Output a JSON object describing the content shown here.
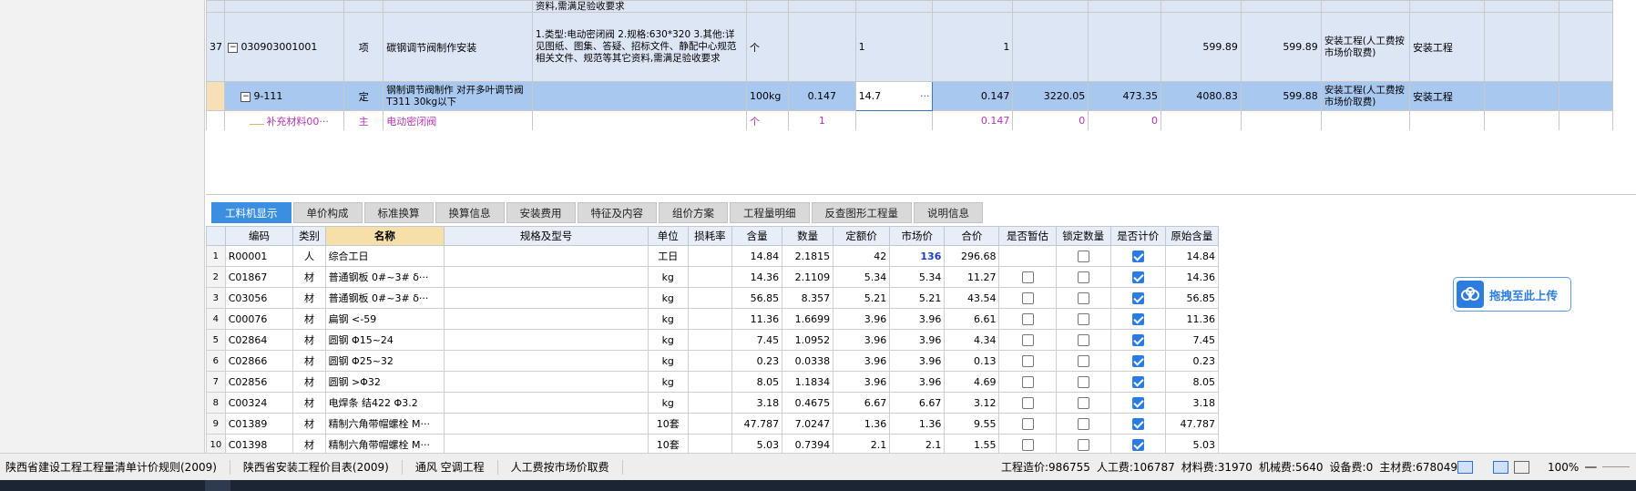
{
  "top_rows": {
    "partial": {
      "spec": "资料,需满足验收要求"
    },
    "r37": {
      "index": "37",
      "code": "030903001001",
      "type": "项",
      "name": "碳钢调节阀制作安装",
      "spec": "1.类型:电动密闭阀 2.规格:630*320 3.其他:详见图纸、图集、答疑、招标文件、静配中心规范相关文件、规范等其它资料,需满足验收要求",
      "unit": "个",
      "qty_expr": "1",
      "qty": "1",
      "unit_price": "599.89",
      "total": "599.89",
      "fee_type": "安装工程(人工费按市场价取费)",
      "major": "安装工程"
    },
    "sel": {
      "code": "9-111",
      "type": "定",
      "name": "钢制调节阀制作 对开多叶调节阀T311 30kg以下",
      "unit": "100kg",
      "content": "0.147",
      "qty_expr": "14.7",
      "more": "···",
      "qty": "0.147",
      "base_price": "3220.05",
      "labor": "473.35",
      "unit_price": "4080.83",
      "total": "599.88",
      "fee_type": "安装工程(人工费按市场价取费)",
      "major": "安装工程"
    },
    "sup": {
      "code": "补充材料00···",
      "type": "主",
      "name": "电动密闭阀",
      "unit": "个",
      "content": "1",
      "qty": "0.147",
      "price": "0",
      "total": "0"
    }
  },
  "tabs": [
    "工料机显示",
    "单价构成",
    "标准换算",
    "换算信息",
    "安装费用",
    "特征及内容",
    "组价方案",
    "工程量明细",
    "反查图形工程量",
    "说明信息"
  ],
  "bottom": {
    "headers": [
      "",
      "编码",
      "类别",
      "名称",
      "规格及型号",
      "单位",
      "损耗率",
      "含量",
      "数量",
      "定额价",
      "市场价",
      "合价",
      "是否暂估",
      "锁定数量",
      "是否计价",
      "原始含量"
    ],
    "rows": [
      {
        "n": "1",
        "code": "R00001",
        "cat": "人",
        "name": "综合工日",
        "spec": "",
        "unit": "工日",
        "loss": "",
        "content": "14.84",
        "qty": "2.1815",
        "base": "42",
        "market": "136",
        "total": "296.68",
        "est": "",
        "lock": false,
        "price": true,
        "orig": "14.84"
      },
      {
        "n": "2",
        "code": "C01867",
        "cat": "材",
        "name": "普通钢板 0#~3# δ···",
        "spec": "",
        "unit": "kg",
        "loss": "",
        "content": "14.36",
        "qty": "2.1109",
        "base": "5.34",
        "market": "5.34",
        "total": "11.27",
        "est": false,
        "lock": false,
        "price": true,
        "orig": "14.36"
      },
      {
        "n": "3",
        "code": "C03056",
        "cat": "材",
        "name": "普通钢板 0#~3# δ···",
        "spec": "",
        "unit": "kg",
        "loss": "",
        "content": "56.85",
        "qty": "8.357",
        "base": "5.21",
        "market": "5.21",
        "total": "43.54",
        "est": false,
        "lock": false,
        "price": true,
        "orig": "56.85"
      },
      {
        "n": "4",
        "code": "C00076",
        "cat": "材",
        "name": "扁钢 <-59",
        "spec": "",
        "unit": "kg",
        "loss": "",
        "content": "11.36",
        "qty": "1.6699",
        "base": "3.96",
        "market": "3.96",
        "total": "6.61",
        "est": false,
        "lock": false,
        "price": true,
        "orig": "11.36"
      },
      {
        "n": "5",
        "code": "C02864",
        "cat": "材",
        "name": "圆钢 Φ15~24",
        "spec": "",
        "unit": "kg",
        "loss": "",
        "content": "7.45",
        "qty": "1.0952",
        "base": "3.96",
        "market": "3.96",
        "total": "4.34",
        "est": false,
        "lock": false,
        "price": true,
        "orig": "7.45"
      },
      {
        "n": "6",
        "code": "C02866",
        "cat": "材",
        "name": "圆钢 Φ25~32",
        "spec": "",
        "unit": "kg",
        "loss": "",
        "content": "0.23",
        "qty": "0.0338",
        "base": "3.96",
        "market": "3.96",
        "total": "0.13",
        "est": false,
        "lock": false,
        "price": true,
        "orig": "0.23"
      },
      {
        "n": "7",
        "code": "C02856",
        "cat": "材",
        "name": "圆钢 >Φ32",
        "spec": "",
        "unit": "kg",
        "loss": "",
        "content": "8.05",
        "qty": "1.1834",
        "base": "3.96",
        "market": "3.96",
        "total": "4.69",
        "est": false,
        "lock": false,
        "price": true,
        "orig": "8.05"
      },
      {
        "n": "8",
        "code": "C00324",
        "cat": "材",
        "name": "电焊条 结422 Φ3.2",
        "spec": "",
        "unit": "kg",
        "loss": "",
        "content": "3.18",
        "qty": "0.4675",
        "base": "6.67",
        "market": "6.67",
        "total": "3.12",
        "est": false,
        "lock": false,
        "price": true,
        "orig": "3.18"
      },
      {
        "n": "9",
        "code": "C01389",
        "cat": "材",
        "name": "精制六角带帽螺栓 M···",
        "spec": "",
        "unit": "10套",
        "loss": "",
        "content": "47.787",
        "qty": "7.0247",
        "base": "1.36",
        "market": "1.36",
        "total": "9.55",
        "est": false,
        "lock": false,
        "price": true,
        "orig": "47.787"
      },
      {
        "n": "10",
        "code": "C01398",
        "cat": "材",
        "name": "精制六角带帽螺栓 M···",
        "spec": "",
        "unit": "10套",
        "loss": "",
        "content": "5.03",
        "qty": "0.7394",
        "base": "2.1",
        "market": "2.1",
        "total": "1.55",
        "est": false,
        "lock": false,
        "price": true,
        "orig": "5.03"
      }
    ]
  },
  "upload": {
    "label": "拖拽至此上传"
  },
  "status": {
    "items": [
      "陕西省建设工程工程量清单计价规则(2009)",
      "陕西省安装工程价目表(2009)",
      "通风 空调工程",
      "人工费按市场价取费"
    ],
    "summary": [
      "工程造价:986755",
      "人工费:106787",
      "材料费:31970",
      "机械费:5640",
      "设备费:0",
      "主材费:678049"
    ],
    "zoom": "100%",
    "zoom_minus": "—"
  },
  "colors": {
    "accent": "#3c8fe0",
    "selected_row": "#a8c8ef",
    "supplement_text": "#b236b2",
    "market_price": "#1c3ec9"
  }
}
